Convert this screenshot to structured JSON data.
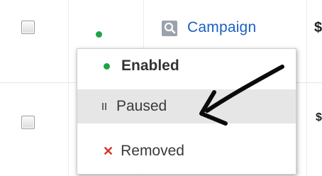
{
  "table": {
    "rows": [
      {
        "status_color": "#1fa34a",
        "name": "Campaign"
      },
      {
        "status_color": null,
        "name": ""
      }
    ],
    "right_cut_glyph": "$"
  },
  "status_menu": {
    "items": [
      {
        "label": "Enabled",
        "icon": "green-dot-icon",
        "selected": true,
        "hovered": false
      },
      {
        "label": "Paused",
        "icon": "pause-icon",
        "selected": false,
        "hovered": true
      },
      {
        "label": "Removed",
        "icon": "red-x-icon",
        "selected": false,
        "hovered": false
      }
    ]
  },
  "colors": {
    "enabled": "#1fa34a",
    "removed": "#d93025",
    "link": "#1a5fc7",
    "hover": "#e6e6e6"
  }
}
